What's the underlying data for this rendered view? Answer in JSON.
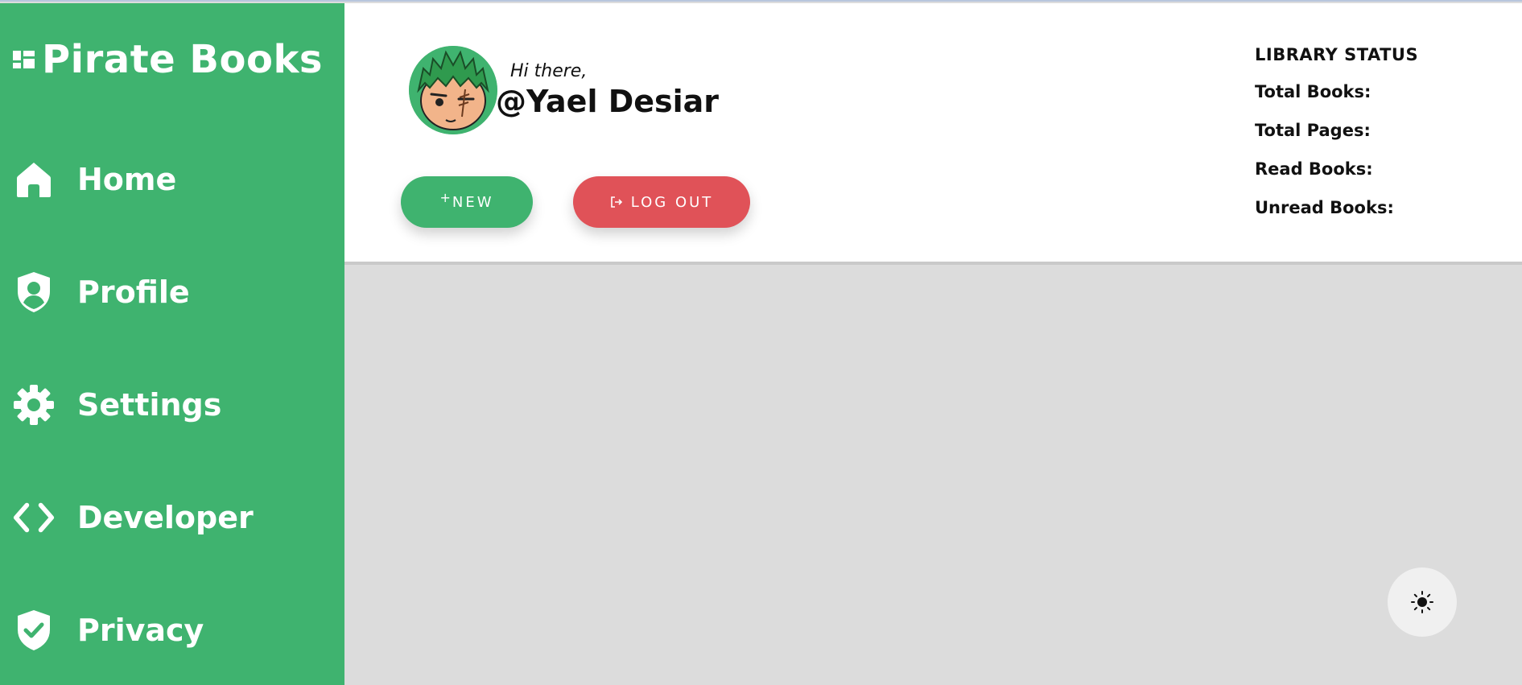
{
  "app": {
    "title": "Pirate Books"
  },
  "sidebar": {
    "items": [
      {
        "label": "Home",
        "icon": "home-icon"
      },
      {
        "label": "Profile",
        "icon": "user-shield-icon"
      },
      {
        "label": "Settings",
        "icon": "gear-icon"
      },
      {
        "label": "Developer",
        "icon": "code-icon"
      },
      {
        "label": "Privacy",
        "icon": "shield-check-icon"
      }
    ]
  },
  "header": {
    "greeting": "Hi there,",
    "username": "@Yael Desiar",
    "avatar_icon": "avatar-image",
    "buttons": {
      "new_label": "NEW",
      "new_prefix": "+",
      "logout_label": "LOG OUT"
    }
  },
  "library_status": {
    "title": "LIBRARY STATUS",
    "rows": [
      {
        "label": "Total Books:",
        "value": ""
      },
      {
        "label": "Total Pages:",
        "value": ""
      },
      {
        "label": "Read Books:",
        "value": ""
      },
      {
        "label": "Unread Books:",
        "value": ""
      }
    ]
  },
  "theme_toggle": {
    "icon": "sun-icon"
  },
  "colors": {
    "brand_green": "#3fb36f",
    "logout_red": "#e05258",
    "content_bg": "#dcdcdc",
    "header_bg": "#ffffff"
  }
}
